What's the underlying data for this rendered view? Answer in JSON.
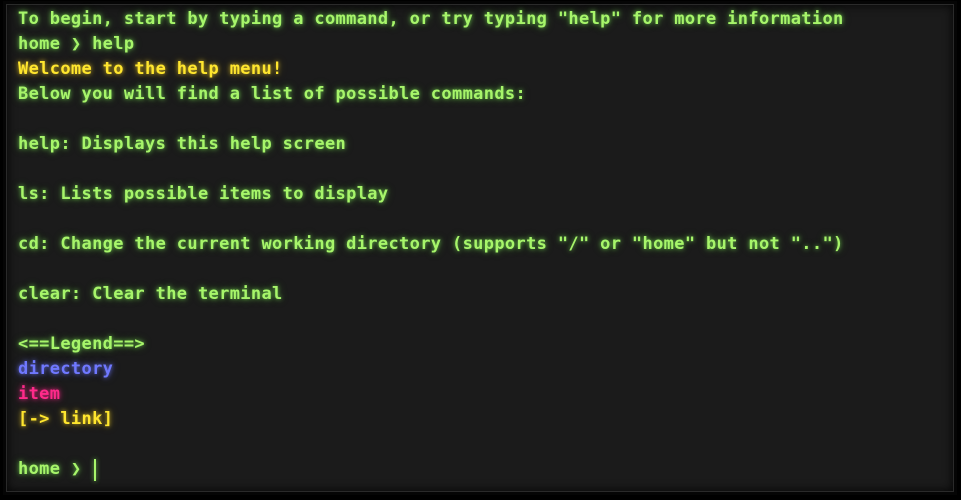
{
  "terminal": {
    "intro": "To begin, start by typing a command, or try typing \"help\" for more information",
    "history_prompt": "home ❯ help",
    "welcome": "Welcome to the help menu!",
    "below": "Below you will find a list of possible commands:",
    "commands": [
      "help: Displays this help screen",
      "ls: Lists possible items to display",
      "cd: Change the current working directory (supports \"/\" or \"home\" but not \"..\")",
      "clear: Clear the terminal"
    ],
    "legend": {
      "header": "<==Legend==>",
      "directory": "directory",
      "item": "item",
      "link": "[-> link]"
    },
    "prompt": "home ❯",
    "input_value": ""
  },
  "colors": {
    "background": "#1b1b1b",
    "text_green": "#a7f56a",
    "text_yellow": "#ffe62e",
    "directory_blue": "#6f78ff",
    "item_pink": "#ff2a8a"
  }
}
